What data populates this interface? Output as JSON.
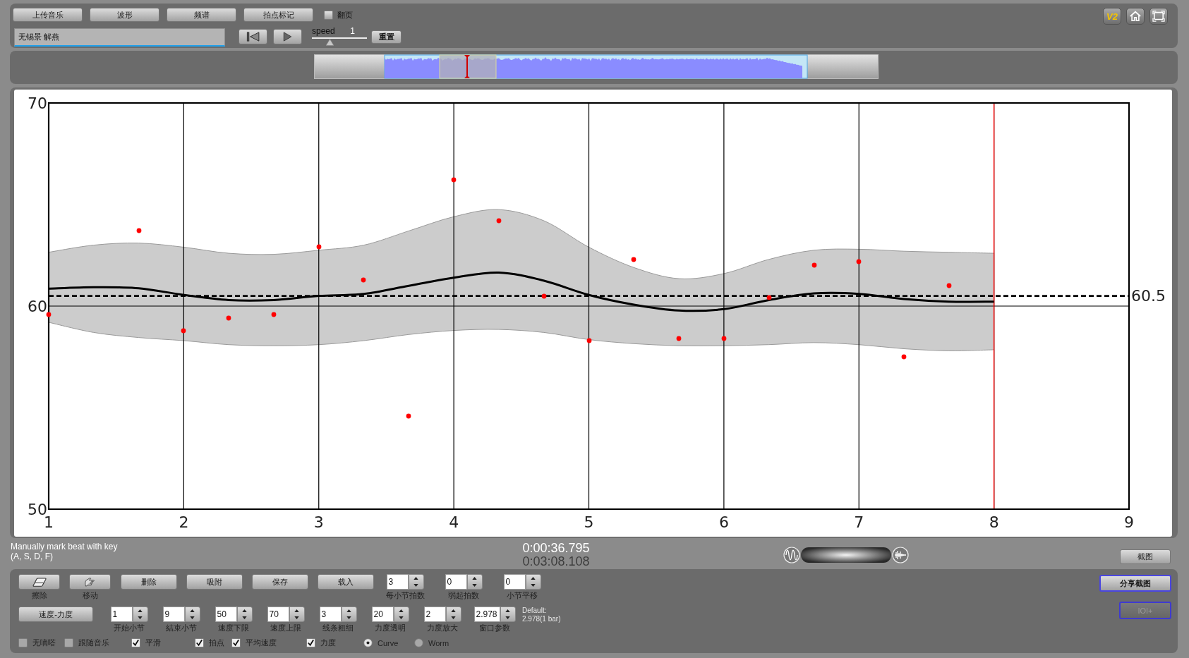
{
  "toolbar": {
    "buttons": [
      "上传音乐",
      "波形",
      "频谱",
      "拍点标记"
    ],
    "page_flip": {
      "label": "翻页",
      "checked": false
    }
  },
  "track_field": {
    "value": "无锡景 解燕"
  },
  "transport": {
    "speed": {
      "label": "speed",
      "value": "1",
      "level": 0.32
    },
    "reset_button": "重置"
  },
  "corner": {
    "version_button": "V2"
  },
  "chart": {
    "chart_data": {
      "type": "line",
      "xlim": [
        1,
        9
      ],
      "ylim": [
        50,
        70
      ],
      "xticks": [
        1,
        2,
        3,
        4,
        5,
        6,
        7,
        8,
        9
      ],
      "yticks": [
        50,
        60,
        70
      ],
      "grid": true,
      "x": [
        1,
        1.333,
        1.667,
        2,
        2.333,
        2.667,
        3,
        3.333,
        3.667,
        4,
        4.333,
        4.667,
        5,
        5.333,
        5.667,
        6,
        6.333,
        6.667,
        7,
        7.333,
        7.667,
        8
      ],
      "series": [
        {
          "type": "area",
          "color": "#cccccc",
          "values": [
            62.65,
            63.0,
            63.1,
            62.9,
            62.6,
            62.55,
            62.75,
            63.0,
            63.7,
            64.4,
            64.75,
            64.2,
            62.9,
            61.9,
            61.35,
            61.6,
            62.3,
            62.75,
            62.8,
            62.7,
            62.65,
            62.6
          ]
        },
        {
          "type": "area",
          "color": "#ffffff",
          "values": [
            59.2,
            58.7,
            58.45,
            58.3,
            58.1,
            58.05,
            58.1,
            58.3,
            58.6,
            58.8,
            58.85,
            58.7,
            58.35,
            58.15,
            58.05,
            58.05,
            58.1,
            58.2,
            58.1,
            57.9,
            57.8,
            57.85
          ]
        },
        {
          "color": "#000000",
          "values": [
            60.86,
            60.93,
            60.88,
            60.55,
            60.3,
            60.3,
            60.5,
            60.6,
            61.0,
            61.4,
            61.65,
            61.25,
            60.55,
            60.07,
            59.78,
            59.85,
            60.3,
            60.62,
            60.6,
            60.35,
            60.22,
            60.22
          ]
        },
        {
          "type": "scatter",
          "color": "#ff0000",
          "values": [
            59.6,
            null,
            63.7,
            58.8,
            59.4,
            59.6,
            62.9,
            61.3,
            54.6,
            66.2,
            64.2,
            60.5,
            58.3,
            62.3,
            58.4,
            58.4,
            60.4,
            62.0,
            62.2,
            57.5,
            61.0,
            null
          ]
        }
      ],
      "ref_lines": [
        {
          "axis": "y",
          "value": 60.5,
          "label": "60.5",
          "color": "#000000"
        },
        {
          "axis": "x",
          "value": 8,
          "color": "#ff0000"
        }
      ]
    }
  },
  "hint": "Manually mark beat with key\n(A, S, D, F)",
  "time": {
    "current": "0:00:36.795",
    "total": "0:03:08.108"
  },
  "screenshot_button": "截图",
  "tools": {
    "icon_tools": [
      {
        "caption": "擦除"
      },
      {
        "caption": "移动"
      }
    ],
    "buttons": [
      "删除",
      "吸附",
      "保存",
      "载入"
    ],
    "spinners": [
      {
        "value": "3",
        "caption": "每小节拍数"
      },
      {
        "value": "0",
        "caption": "弱起拍数"
      },
      {
        "value": "0",
        "caption": "小节平移"
      }
    ]
  },
  "params": {
    "mode_button": "速度-力度",
    "spinners": [
      {
        "value": "1",
        "caption": "开始小节"
      },
      {
        "value": "9",
        "caption": "結束小节"
      },
      {
        "value": "50",
        "caption": "速度下限"
      },
      {
        "value": "70",
        "caption": "速度上限"
      },
      {
        "value": "3",
        "caption": "线条粗细"
      },
      {
        "value": "20",
        "caption": "力度透明"
      },
      {
        "value": "2",
        "caption": "力度放大"
      },
      {
        "value": "2.978",
        "caption": "窗口参数"
      }
    ],
    "default_note": "Default:\n2.978(1 bar)"
  },
  "options": [
    {
      "kind": "checkbox",
      "label": "无嘀嗒",
      "checked": false
    },
    {
      "kind": "checkbox",
      "label": "跟随音乐",
      "checked": false
    },
    {
      "kind": "checkbox",
      "label": "平滑",
      "checked": true
    },
    {
      "kind": "checkbox",
      "label": "拍点",
      "checked": true
    },
    {
      "kind": "checkbox",
      "label": "平均速度",
      "checked": true
    },
    {
      "kind": "checkbox",
      "label": "力度",
      "checked": true
    },
    {
      "kind": "radio",
      "label": "Curve",
      "selected": true
    },
    {
      "kind": "radio",
      "label": "Worm",
      "selected": false
    }
  ],
  "share_button": {
    "label": "分享截图"
  },
  "ioi_button": {
    "label": "IOI+",
    "disabled": true
  }
}
